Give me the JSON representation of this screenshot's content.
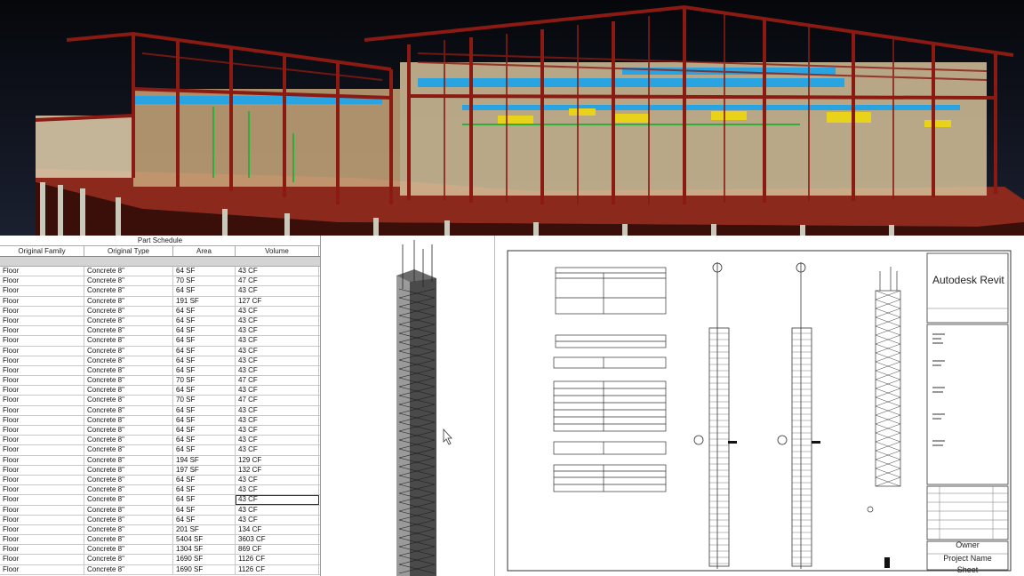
{
  "schedule": {
    "title": "Part Schedule",
    "columns": [
      "Original Family",
      "Original Type",
      "Area",
      "Volume"
    ],
    "rows": [
      [
        "Floor",
        "Concrete 8\"",
        "64 SF",
        "43 CF"
      ],
      [
        "Floor",
        "Concrete 8\"",
        "70 SF",
        "47 CF"
      ],
      [
        "Floor",
        "Concrete 8\"",
        "64 SF",
        "43 CF"
      ],
      [
        "Floor",
        "Concrete 8\"",
        "191 SF",
        "127 CF"
      ],
      [
        "Floor",
        "Concrete 8\"",
        "64 SF",
        "43 CF"
      ],
      [
        "Floor",
        "Concrete 8\"",
        "64 SF",
        "43 CF"
      ],
      [
        "Floor",
        "Concrete 8\"",
        "64 SF",
        "43 CF"
      ],
      [
        "Floor",
        "Concrete 8\"",
        "64 SF",
        "43 CF"
      ],
      [
        "Floor",
        "Concrete 8\"",
        "64 SF",
        "43 CF"
      ],
      [
        "Floor",
        "Concrete 8\"",
        "64 SF",
        "43 CF"
      ],
      [
        "Floor",
        "Concrete 8\"",
        "64 SF",
        "43 CF"
      ],
      [
        "Floor",
        "Concrete 8\"",
        "70 SF",
        "47 CF"
      ],
      [
        "Floor",
        "Concrete 8\"",
        "64 SF",
        "43 CF"
      ],
      [
        "Floor",
        "Concrete 8\"",
        "70 SF",
        "47 CF"
      ],
      [
        "Floor",
        "Concrete 8\"",
        "64 SF",
        "43 CF"
      ],
      [
        "Floor",
        "Concrete 8\"",
        "64 SF",
        "43 CF"
      ],
      [
        "Floor",
        "Concrete 8\"",
        "64 SF",
        "43 CF"
      ],
      [
        "Floor",
        "Concrete 8\"",
        "64 SF",
        "43 CF"
      ],
      [
        "Floor",
        "Concrete 8\"",
        "64 SF",
        "43 CF"
      ],
      [
        "Floor",
        "Concrete 8\"",
        "194 SF",
        "129 CF"
      ],
      [
        "Floor",
        "Concrete 8\"",
        "197 SF",
        "132 CF"
      ],
      [
        "Floor",
        "Concrete 8\"",
        "64 SF",
        "43 CF"
      ],
      [
        "Floor",
        "Concrete 8\"",
        "64 SF",
        "43 CF"
      ],
      [
        "Floor",
        "Concrete 8\"",
        "64 SF",
        "43 CF"
      ],
      [
        "Floor",
        "Concrete 8\"",
        "64 SF",
        "43 CF"
      ],
      [
        "Floor",
        "Concrete 8\"",
        "64 SF",
        "43 CF"
      ],
      [
        "Floor",
        "Concrete 8\"",
        "201 SF",
        "134 CF"
      ],
      [
        "Floor",
        "Concrete 8\"",
        "5404 SF",
        "3603 CF"
      ],
      [
        "Floor",
        "Concrete 8\"",
        "1304 SF",
        "869 CF"
      ],
      [
        "Floor",
        "Concrete 8\"",
        "1690 SF",
        "1126 CF"
      ],
      [
        "Floor",
        "Concrete 8\"",
        "1690 SF",
        "1126 CF"
      ]
    ],
    "selected_row": 23
  },
  "sheet": {
    "brand": "Autodesk Revit",
    "owner_label": "Owner",
    "project_label": "Project Name",
    "sheet_label": "Sheet"
  },
  "colors": {
    "steel": "#8a1a12",
    "duct": "#2aa4e0",
    "light": "#e8d21a",
    "pipe": "#2fae3a"
  }
}
